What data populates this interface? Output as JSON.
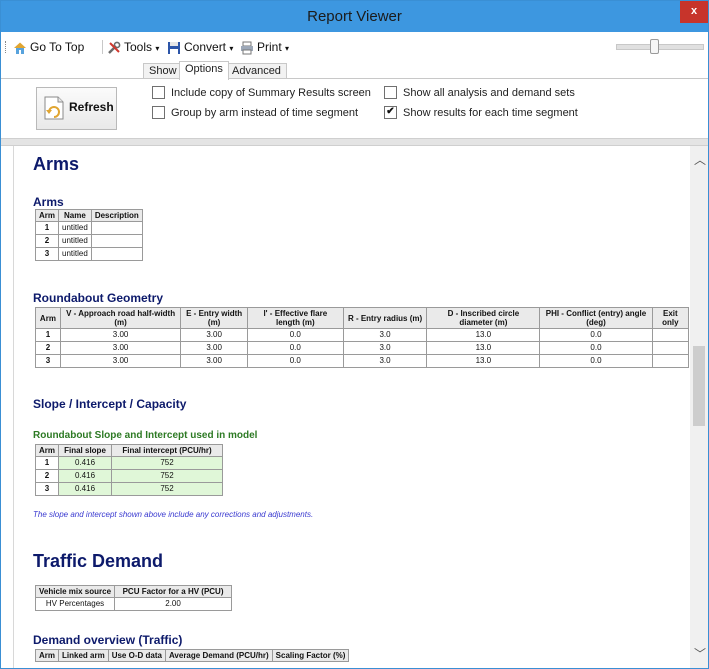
{
  "window": {
    "title": "Report Viewer",
    "close_label": "x"
  },
  "toolbar": {
    "go_to_top": "Go To Top",
    "tools": "Tools",
    "convert": "Convert",
    "print": "Print"
  },
  "tabs": [
    {
      "label": "Show",
      "active": false
    },
    {
      "label": "Options",
      "active": true
    },
    {
      "label": "Advanced",
      "active": false
    }
  ],
  "options": {
    "refresh_label": "Refresh",
    "checkboxes": [
      {
        "label": "Include copy of Summary Results screen",
        "checked": false
      },
      {
        "label": "Group by arm instead of time segment",
        "checked": false
      },
      {
        "label": "Show all analysis and demand sets",
        "checked": false
      },
      {
        "label": "Show results for each time segment",
        "checked": true
      }
    ]
  },
  "report": {
    "arms_heading": "Arms",
    "arms_sub": "Arms",
    "arms_table": {
      "headers": [
        "Arm",
        "Name",
        "Description"
      ],
      "rows": [
        [
          "1",
          "untitled",
          ""
        ],
        [
          "2",
          "untitled",
          ""
        ],
        [
          "3",
          "untitled",
          ""
        ]
      ]
    },
    "geometry_heading": "Roundabout Geometry",
    "geometry_table": {
      "headers": [
        "Arm",
        "V - Approach road half-width (m)",
        "E - Entry width (m)",
        "l' - Effective flare length (m)",
        "R - Entry radius (m)",
        "D - Inscribed circle diameter (m)",
        "PHI - Conflict (entry) angle (deg)",
        "Exit only"
      ],
      "rows": [
        [
          "1",
          "3.00",
          "3.00",
          "0.0",
          "3.0",
          "13.0",
          "0.0",
          ""
        ],
        [
          "2",
          "3.00",
          "3.00",
          "0.0",
          "3.0",
          "13.0",
          "0.0",
          ""
        ],
        [
          "3",
          "3.00",
          "3.00",
          "0.0",
          "3.0",
          "13.0",
          "0.0",
          ""
        ]
      ]
    },
    "slope_heading": "Slope / Intercept / Capacity",
    "slope_sub": "Roundabout Slope and Intercept used in model",
    "slope_table": {
      "headers": [
        "Arm",
        "Final slope",
        "Final intercept (PCU/hr)"
      ],
      "rows": [
        [
          "1",
          "0.416",
          "752"
        ],
        [
          "2",
          "0.416",
          "752"
        ],
        [
          "3",
          "0.416",
          "752"
        ]
      ]
    },
    "slope_note": "The slope and intercept shown above include any corrections and adjustments.",
    "traffic_heading": "Traffic Demand",
    "vehicle_table": {
      "headers": [
        "Vehicle mix source",
        "PCU Factor for a HV (PCU)"
      ],
      "rows": [
        [
          "HV Percentages",
          "2.00"
        ]
      ]
    },
    "demand_heading": "Demand overview (Traffic)",
    "demand_table": {
      "headers": [
        "Arm",
        "Linked arm",
        "Use O-D data",
        "Average Demand (PCU/hr)",
        "Scaling Factor (%)"
      ]
    }
  }
}
